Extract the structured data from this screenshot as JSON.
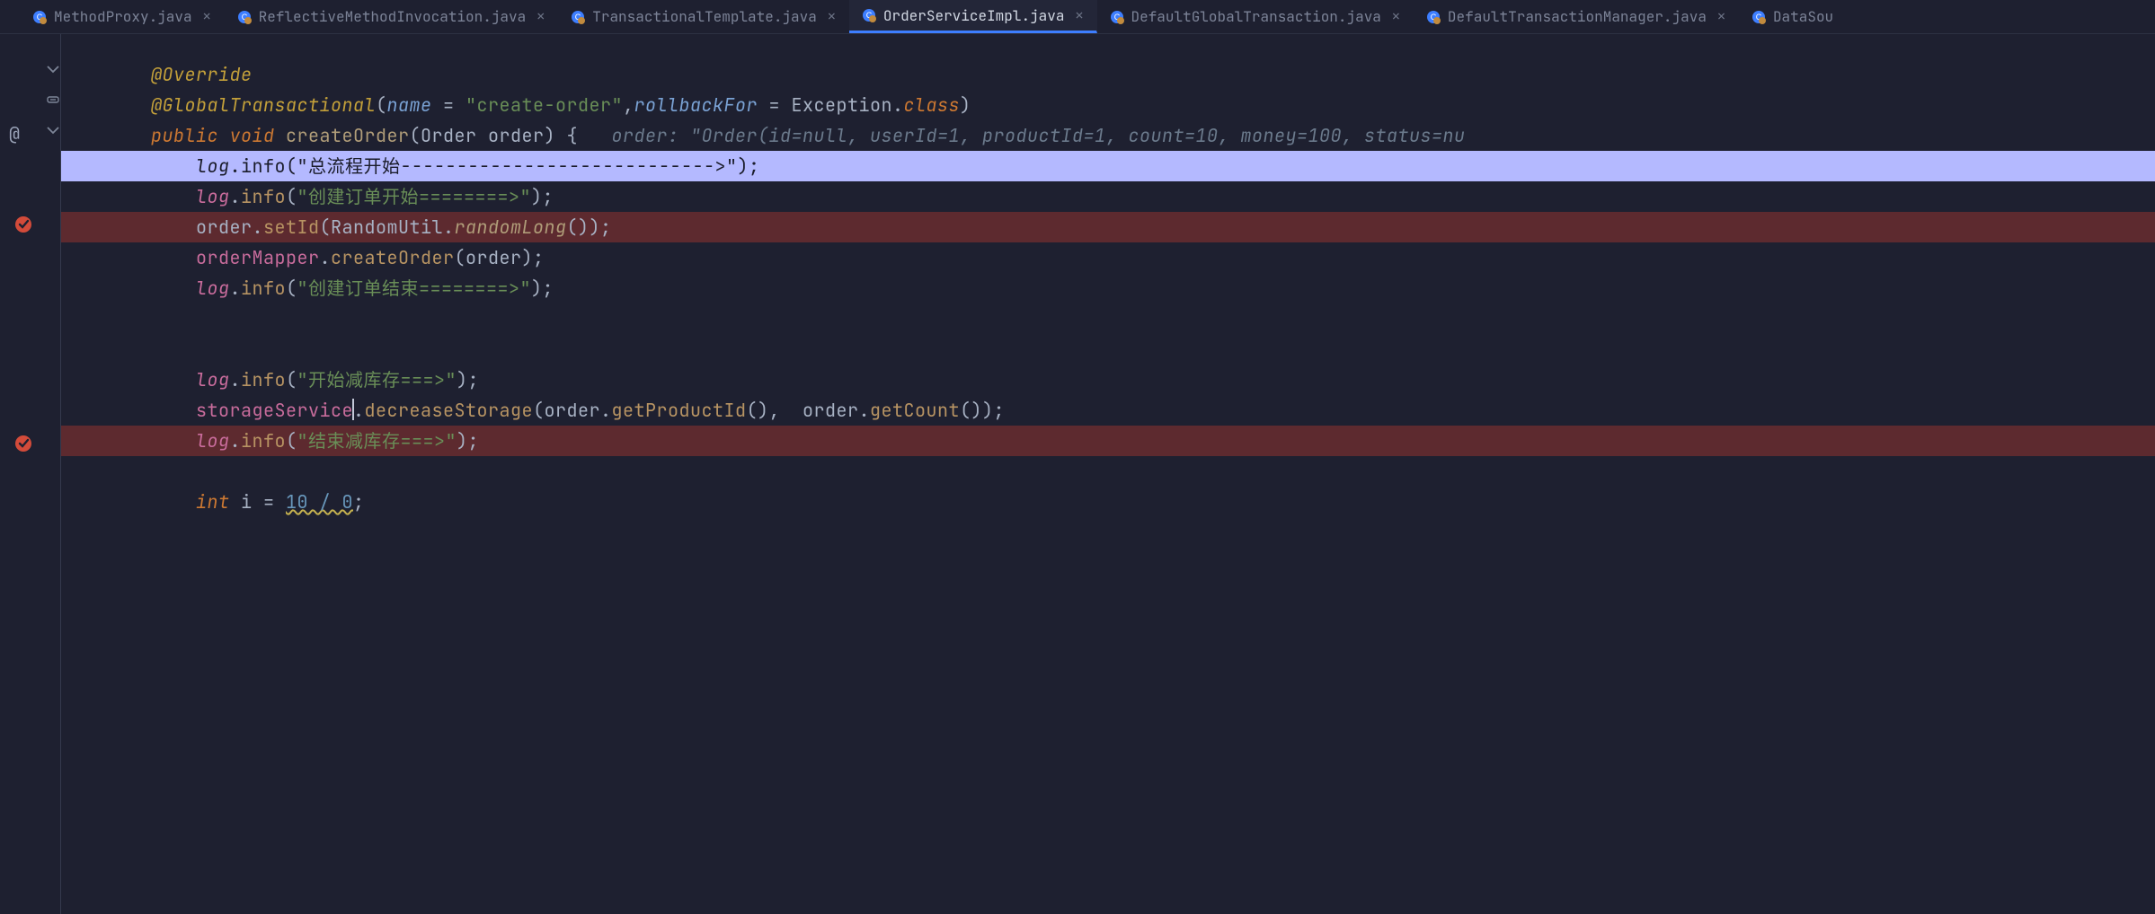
{
  "tabs": [
    {
      "label": "MethodProxy.java",
      "active": false
    },
    {
      "label": "ReflectiveMethodInvocation.java",
      "active": false
    },
    {
      "label": "TransactionalTemplate.java",
      "active": false
    },
    {
      "label": "OrderServiceImpl.java",
      "active": true
    },
    {
      "label": "DefaultGlobalTransaction.java",
      "active": false
    },
    {
      "label": "DefaultTransactionManager.java",
      "active": false
    },
    {
      "label": "DataSou",
      "active": false,
      "truncated": true
    }
  ],
  "gutter": {
    "override_at_icon": "@",
    "breakpoint_lines": [
      5,
      12
    ],
    "fold_lines": [
      1,
      2,
      3
    ]
  },
  "code": {
    "indent1": "        ",
    "indent2": "            ",
    "l1": {
      "anno": "@Override"
    },
    "l2": {
      "anno": "@GlobalTransactional",
      "lparen": "(",
      "name_key": "name",
      "eq1": " = ",
      "name_val": "\"create-order\"",
      "comma": ",",
      "rb_key": "rollbackFor",
      "eq2": " = ",
      "exc": "Exception",
      "dot": ".",
      "class_kw": "class",
      "rparen": ")"
    },
    "l3": {
      "pub": "public",
      "voidkw": " void ",
      "method": "createOrder",
      "lparen": "(",
      "ptype": "Order",
      "pname": " order",
      "rparen": ") ",
      "lbrace": "{",
      "hint_label": "   order: ",
      "hint_val": "\"Order(id=null, userId=1, productId=1, count=10, money=100, status=nu"
    },
    "l4": {
      "log": "log",
      "dot": ".",
      "info": "info",
      "lparen": "(",
      "str": "\"总流程开始---------------------------->\"",
      "rparen": ");"
    },
    "l5": {
      "log": "log",
      "dot": ".",
      "info": "info",
      "lparen": "(",
      "str": "\"创建订单开始========>\"",
      "rparen": ");"
    },
    "l6": {
      "order": "order",
      "dot1": ".",
      "setId": "setId",
      "lparen": "(",
      "rutil": "RandomUtil",
      "dot2": ".",
      "rlong": "randomLong",
      "args": "()",
      "rparen": ");"
    },
    "l7": {
      "om": "orderMapper",
      "dot": ".",
      "co": "createOrder",
      "lparen": "(",
      "order": "order",
      "rparen": ");"
    },
    "l8": {
      "log": "log",
      "dot": ".",
      "info": "info",
      "lparen": "(",
      "str": "\"创建订单结束========>\"",
      "rparen": ");"
    },
    "l9": {
      "log": "log",
      "dot": ".",
      "info": "info",
      "lparen": "(",
      "str": "\"开始减库存===>\"",
      "rparen": ");"
    },
    "l10": {
      "svc": "storageService",
      "dot1": ".",
      "dec": "decreaseStorage",
      "lparen": "(",
      "order1": "order",
      "dot2": ".",
      "gp": "getProductId",
      "a1": "(),",
      "sp": "  ",
      "order2": "order",
      "dot3": ".",
      "gc": "getCount",
      "a2": "()",
      "rparen": ");"
    },
    "l11": {
      "log": "log",
      "dot": ".",
      "info": "info",
      "lparen": "(",
      "str": "\"结束减库存===>\"",
      "rparen": ");"
    },
    "l12": {
      "intkw": "int",
      "sp": " ",
      "i": "i",
      "eq": " = ",
      "expr": "10 / 0",
      "semi": ";"
    }
  }
}
